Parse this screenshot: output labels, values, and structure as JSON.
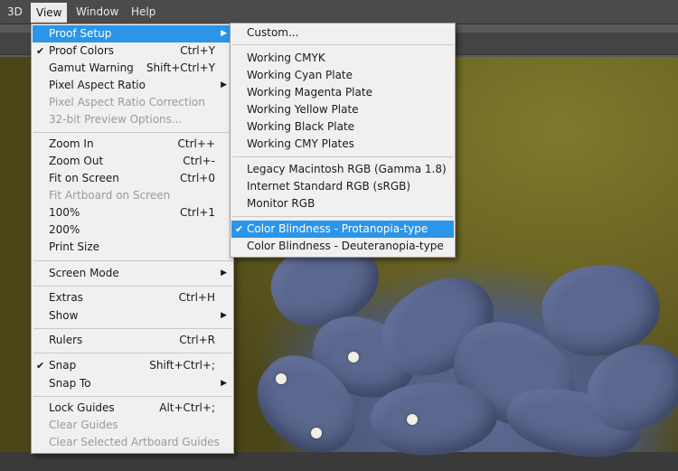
{
  "menubar": {
    "items": [
      {
        "label": "3D"
      },
      {
        "label": "View"
      },
      {
        "label": "Window"
      },
      {
        "label": "Help"
      }
    ]
  },
  "view_menu": {
    "items": [
      {
        "label": "Proof Setup",
        "shortcut": "",
        "submenu": true,
        "highlighted": true
      },
      {
        "label": "Proof Colors",
        "shortcut": "Ctrl+Y",
        "checked": true
      },
      {
        "label": "Gamut Warning",
        "shortcut": "Shift+Ctrl+Y"
      },
      {
        "label": "Pixel Aspect Ratio",
        "shortcut": "",
        "submenu": true
      },
      {
        "label": "Pixel Aspect Ratio Correction",
        "shortcut": "",
        "disabled": true
      },
      {
        "label": "32-bit Preview Options...",
        "shortcut": "",
        "disabled": true
      },
      {
        "label": "Zoom In",
        "shortcut": "Ctrl++"
      },
      {
        "label": "Zoom Out",
        "shortcut": "Ctrl+-"
      },
      {
        "label": "Fit on Screen",
        "shortcut": "Ctrl+0"
      },
      {
        "label": "Fit Artboard on Screen",
        "shortcut": "",
        "disabled": true
      },
      {
        "label": "100%",
        "shortcut": "Ctrl+1"
      },
      {
        "label": "200%",
        "shortcut": ""
      },
      {
        "label": "Print Size",
        "shortcut": ""
      },
      {
        "label": "Screen Mode",
        "shortcut": "",
        "submenu": true
      },
      {
        "label": "Extras",
        "shortcut": "Ctrl+H"
      },
      {
        "label": "Show",
        "shortcut": "",
        "submenu": true
      },
      {
        "label": "Rulers",
        "shortcut": "Ctrl+R"
      },
      {
        "label": "Snap",
        "shortcut": "Shift+Ctrl+;",
        "checked": true
      },
      {
        "label": "Snap To",
        "shortcut": "",
        "submenu": true
      },
      {
        "label": "Lock Guides",
        "shortcut": "Alt+Ctrl+;"
      },
      {
        "label": "Clear Guides",
        "shortcut": "",
        "disabled": true
      },
      {
        "label": "Clear Selected Artboard Guides",
        "shortcut": "",
        "disabled": true
      }
    ]
  },
  "proof_menu": {
    "items": [
      {
        "label": "Custom..."
      },
      {
        "label": "Working CMYK"
      },
      {
        "label": "Working Cyan Plate"
      },
      {
        "label": "Working Magenta Plate"
      },
      {
        "label": "Working Yellow Plate"
      },
      {
        "label": "Working Black Plate"
      },
      {
        "label": "Working CMY Plates"
      },
      {
        "label": "Legacy Macintosh RGB (Gamma 1.8)"
      },
      {
        "label": "Internet Standard RGB (sRGB)"
      },
      {
        "label": "Monitor RGB"
      },
      {
        "label": "Color Blindness - Protanopia-type",
        "checked": true,
        "highlighted": true
      },
      {
        "label": "Color Blindness - Deuteranopia-type"
      }
    ]
  },
  "icons": {
    "check": "check-icon",
    "submenu_arrow": "chevron-right-icon"
  },
  "colors": {
    "highlight": "#2b95e9",
    "menu_bg": "#f0f0f0",
    "menubar_bg": "#4b4b4b",
    "disabled_text": "#9a9a9a"
  }
}
